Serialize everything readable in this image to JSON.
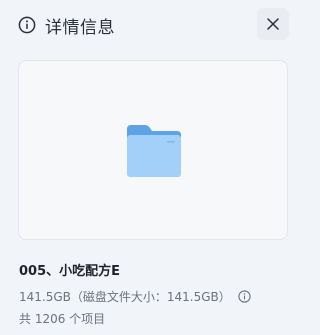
{
  "header": {
    "title": "详情信息",
    "icon": "info-icon"
  },
  "close_button": {
    "icon": "close-icon"
  },
  "preview": {
    "icon": "folder-icon",
    "folder_color": "#7fb8f0"
  },
  "details": {
    "name": "005、小吃配方E",
    "size": "141.5GB",
    "disk_size": "（磁盘文件大小：141.5GB）",
    "help_icon": "question-circle-icon",
    "item_count": "共 1206 个项目"
  }
}
